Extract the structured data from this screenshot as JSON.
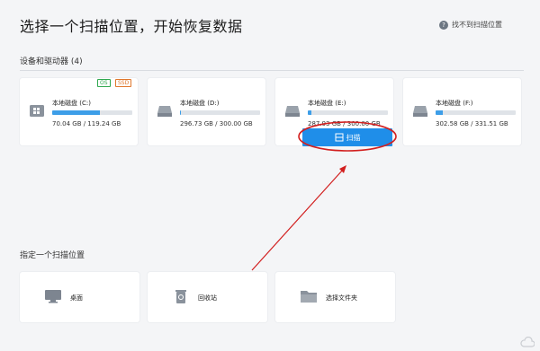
{
  "header": {
    "title": "选择一个扫描位置，开始恢复数据",
    "help_label": "找不到扫描位置",
    "help_icon": "question-icon"
  },
  "devices": {
    "section_label": "设备和驱动器 (4)",
    "drives": [
      {
        "name": "本地磁盘 (C:)",
        "size": "70.04 GB / 119.24 GB",
        "used_fraction": 0.59,
        "badges": [
          "OS",
          "SSD"
        ],
        "icon": "windows-drive-icon"
      },
      {
        "name": "本地磁盘 (D:)",
        "size": "296.73 GB / 300.00 GB",
        "used_fraction": 0.01,
        "badges": [],
        "icon": "hard-drive-icon"
      },
      {
        "name": "本地磁盘 (E:)",
        "size": "287.93 GB / 300.00 GB",
        "used_fraction": 0.04,
        "badges": [],
        "icon": "hard-drive-icon"
      },
      {
        "name": "本地磁盘 (F:)",
        "size": "302.58 GB / 331.51 GB",
        "used_fraction": 0.09,
        "badges": [],
        "icon": "hard-drive-icon"
      }
    ],
    "scan_button_label": "扫描"
  },
  "locations": {
    "section_label": "指定一个扫描位置",
    "items": [
      {
        "label": "桌面",
        "icon": "desktop-icon"
      },
      {
        "label": "回收站",
        "icon": "recycle-bin-icon"
      },
      {
        "label": "选择文件夹",
        "icon": "folder-icon"
      }
    ]
  },
  "colors": {
    "accent": "#1f8ee9",
    "annotation": "#d21f1f",
    "badge_os": "#2fa84f",
    "badge_ssd": "#e0772c"
  }
}
